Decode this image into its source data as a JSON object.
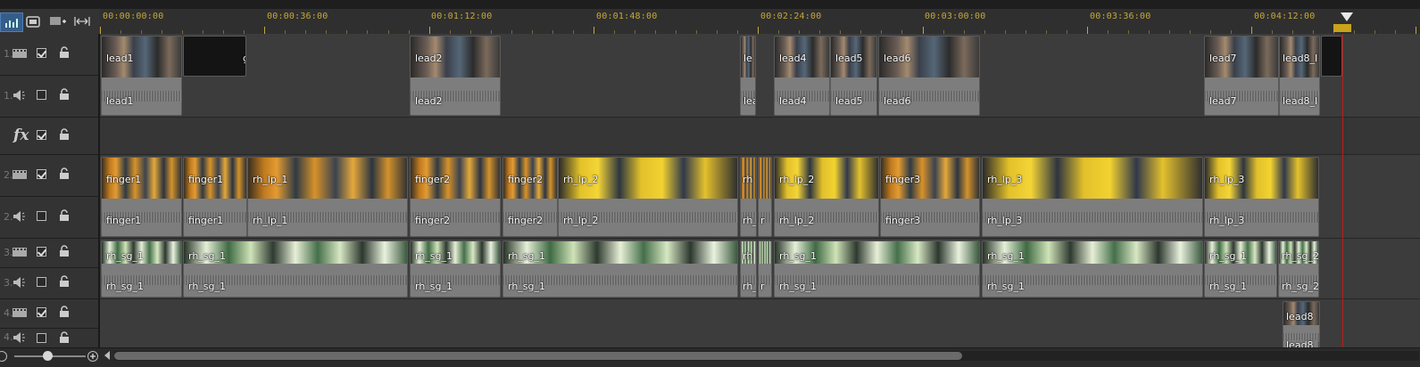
{
  "ruler": {
    "timecodes": [
      "00:00:00:00",
      "00:00:36:00",
      "00:01:12:00",
      "00:01:48:00",
      "00:02:24:00",
      "00:03:00:00",
      "00:03:36:00",
      "00:04:12:00"
    ]
  },
  "tracks": [
    {
      "num": "1.",
      "type": "video",
      "checked": true
    },
    {
      "num": "1.",
      "type": "audio",
      "checked": false
    },
    {
      "num": "",
      "type": "fx",
      "checked": true,
      "label": "fx"
    },
    {
      "num": "2.",
      "type": "video",
      "checked": true
    },
    {
      "num": "2.",
      "type": "audio",
      "checked": false
    },
    {
      "num": "3.",
      "type": "video",
      "checked": true
    },
    {
      "num": "3.",
      "type": "audio",
      "checked": false
    },
    {
      "num": "4.",
      "type": "video",
      "checked": true
    },
    {
      "num": "4.",
      "type": "audio",
      "checked": false
    }
  ],
  "clips": {
    "lead1": "lead1",
    "lead2": "lead2",
    "lead3_v": "le",
    "lead3_a": "lea",
    "lead4": "lead4",
    "lead5": "lead5",
    "lead6": "lead6",
    "lead7": "lead7",
    "lead8_v": "lead8_I",
    "lead8_a": "lead8_I",
    "g_tail": "g",
    "finger1": "finger1",
    "rh_lp_1": "rh_lp_1",
    "finger2": "finger2",
    "rh_lp_2": "rh_lp_2",
    "rh_short": "rh_",
    "rh_tiny_v": "rh",
    "r_tiny": "r",
    "finger3": "finger3",
    "rh_lp_3": "rh_lp_3",
    "rh_sg_1": "rh_sg_1",
    "rh_sg_2": "rh_sg_2",
    "rh_sg_short": "rh_",
    "rh_sg_tiny": "rh",
    "r_sg_tiny": "r",
    "lead8_t4v": "lead8",
    "lead8_t4a": "lead8_I"
  }
}
